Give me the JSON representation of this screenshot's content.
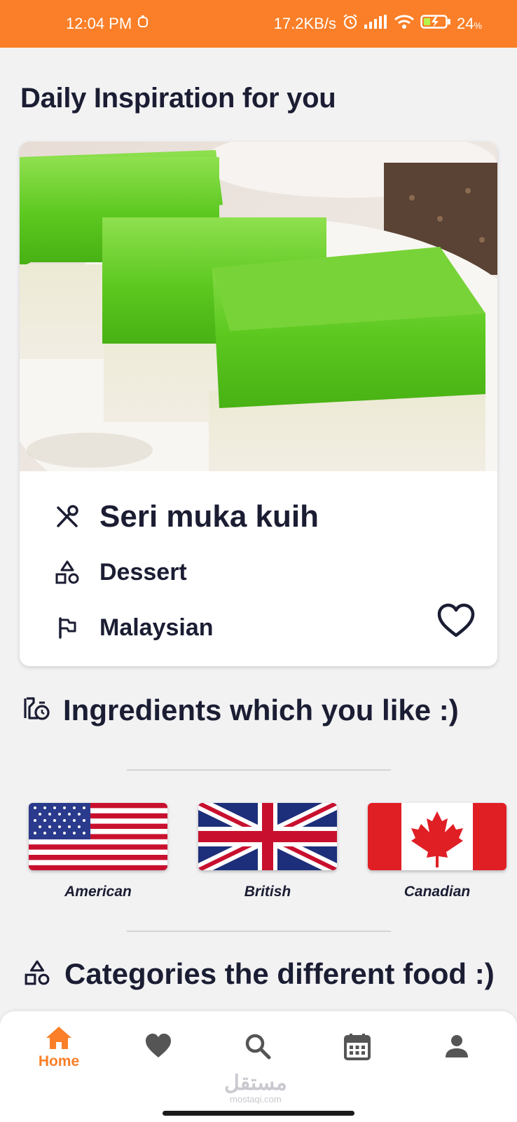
{
  "status_bar": {
    "time": "12:04 PM",
    "net_speed": "17.2KB/s",
    "battery": "24",
    "battery_unit": "%"
  },
  "home": {
    "section_title": "Daily Inspiration for you",
    "recipe": {
      "name": "Seri muka kuih",
      "category": "Dessert",
      "area": "Malaysian"
    },
    "ingredients_title": "Ingredients which you like :)",
    "areas": [
      {
        "label": "American"
      },
      {
        "label": "British"
      },
      {
        "label": "Canadian"
      }
    ],
    "categories_title": "Categories the different food :)"
  },
  "bottom_nav": {
    "active": "home",
    "items": [
      {
        "key": "home",
        "label": "Home",
        "icon": "home-icon"
      },
      {
        "key": "favorites",
        "label": "",
        "icon": "heart-icon"
      },
      {
        "key": "search",
        "label": "",
        "icon": "search-icon"
      },
      {
        "key": "calendar",
        "label": "",
        "icon": "calendar-icon"
      },
      {
        "key": "profile",
        "label": "",
        "icon": "person-icon"
      }
    ]
  },
  "watermark": {
    "arabic": "مستقل",
    "latin": "mostaqi.com"
  },
  "colors": {
    "accent": "#fa7f28",
    "text": "#1b1d33",
    "background": "#f2f2f3",
    "nav_icon": "#555555"
  }
}
